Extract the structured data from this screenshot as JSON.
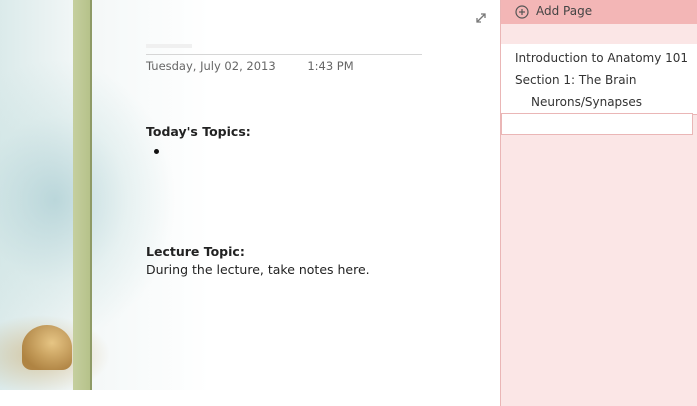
{
  "note": {
    "date": "Tuesday, July 02, 2013",
    "time": "1:43 PM",
    "topics_heading": "Today's Topics:",
    "lecture_heading": "Lecture Topic:",
    "lecture_body": "During the lecture, take notes here."
  },
  "icons": {
    "expand": "expand-arrows-icon",
    "add_page": "plus-circle-icon"
  },
  "page_panel": {
    "add_page_label": "Add Page",
    "pages": [
      {
        "label": "Introduction to Anatomy 101",
        "level": 1
      },
      {
        "label": "Section 1: The Brain",
        "level": 1
      },
      {
        "label": "Neurons/Synapses",
        "level": 2
      }
    ],
    "colors": {
      "header": "#f3b6b6",
      "panel": "#fbe6e6",
      "border": "#eab6b6"
    }
  }
}
